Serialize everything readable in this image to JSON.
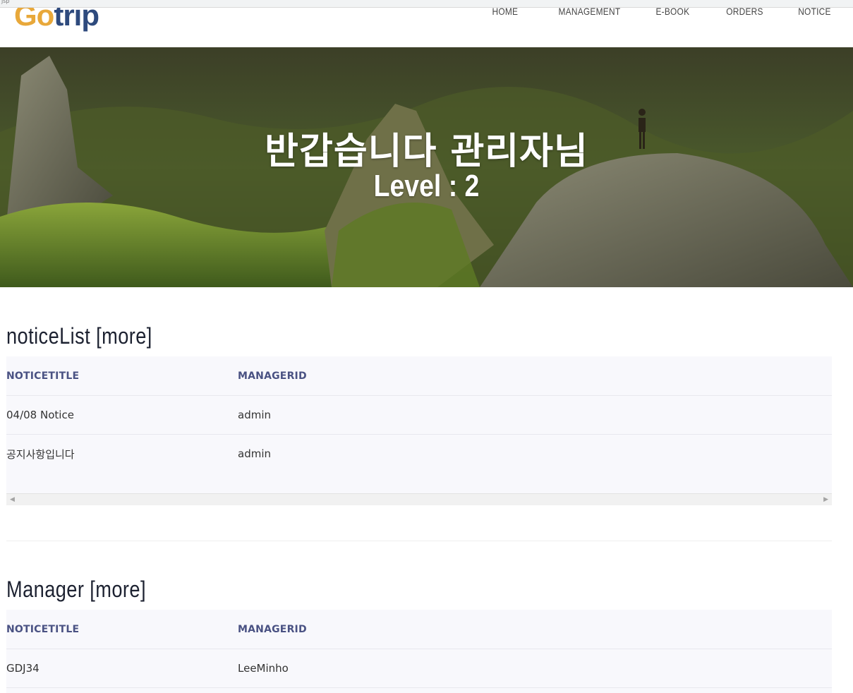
{
  "browser": {
    "tab_fragment": "jsp"
  },
  "header": {
    "logo_go": "Go",
    "logo_trip": "trip",
    "nav": [
      "HOME",
      "MANAGEMENT",
      "E-BOOK",
      "ORDERS",
      "NOTICE"
    ]
  },
  "hero": {
    "greeting": "반갑습니다 관리자님",
    "level": "Level : 2"
  },
  "notice_section": {
    "title": "noticeList [more]",
    "columns": [
      "NOTICETITLE",
      "MANAGERID"
    ],
    "rows": [
      [
        "04/08 Notice",
        "admin"
      ],
      [
        "공지사항입니다",
        "admin"
      ]
    ]
  },
  "manager_section": {
    "title": "Manager [more]",
    "columns": [
      "NOTICETITLE",
      "MANAGERID"
    ],
    "rows": [
      [
        "GDJ34",
        "LeeMinho"
      ]
    ]
  },
  "colors": {
    "logo_orange": "#e8a83a",
    "logo_blue": "#2e4a7d",
    "table_header_text": "#4a5283",
    "table_bg": "#f8f8fc"
  },
  "icons": [
    "scroll-left-arrow-icon",
    "scroll-right-arrow-icon"
  ]
}
